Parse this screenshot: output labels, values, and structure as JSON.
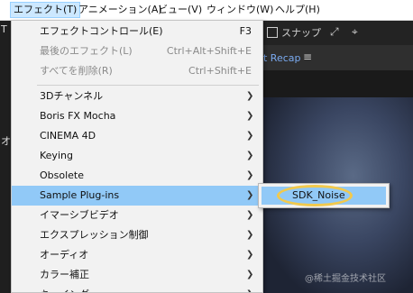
{
  "menubar": {
    "items": [
      {
        "label": "エフェクト(T)",
        "active": true
      },
      {
        "label": "アニメーション(A)",
        "active": false
      },
      {
        "label": "ビュー(V)",
        "active": false
      },
      {
        "label": "ウィンドウ(W)",
        "active": false
      },
      {
        "label": "ヘルプ(H)",
        "active": false
      }
    ]
  },
  "toolbar": {
    "snap_label": "スナップ",
    "icons": [
      "pin-icon",
      "target-icon"
    ]
  },
  "panel": {
    "recap_label": "t Recap",
    "menu_icon": "hamburger-icon"
  },
  "left_glyphs": [
    "T",
    "オ"
  ],
  "dropdown": {
    "items": [
      {
        "label": "エフェクトコントロール(E)",
        "shortcut": "F3",
        "disabled": false,
        "submenu": false
      },
      {
        "label": "最後のエフェクト(L)",
        "shortcut": "Ctrl+Alt+Shift+E",
        "disabled": true,
        "submenu": false
      },
      {
        "label": "すべてを削除(R)",
        "shortcut": "Ctrl+Shift+E",
        "disabled": true,
        "submenu": false
      },
      {
        "label": "3Dチャンネル",
        "shortcut": "",
        "disabled": false,
        "submenu": true
      },
      {
        "label": "Boris FX Mocha",
        "shortcut": "",
        "disabled": false,
        "submenu": true
      },
      {
        "label": "CINEMA 4D",
        "shortcut": "",
        "disabled": false,
        "submenu": true
      },
      {
        "label": "Keying",
        "shortcut": "",
        "disabled": false,
        "submenu": true
      },
      {
        "label": "Obsolete",
        "shortcut": "",
        "disabled": false,
        "submenu": true
      },
      {
        "label": "Sample Plug-ins",
        "shortcut": "",
        "disabled": false,
        "submenu": true,
        "highlighted": true
      },
      {
        "label": "イマーシブビデオ",
        "shortcut": "",
        "disabled": false,
        "submenu": true
      },
      {
        "label": "エクスプレッション制御",
        "shortcut": "",
        "disabled": false,
        "submenu": true
      },
      {
        "label": "オーディオ",
        "shortcut": "",
        "disabled": false,
        "submenu": true
      },
      {
        "label": "カラー補正",
        "shortcut": "",
        "disabled": false,
        "submenu": true
      },
      {
        "label": "キーイング",
        "shortcut": "",
        "disabled": false,
        "submenu": true
      }
    ]
  },
  "submenu": {
    "items": [
      {
        "label": "SDK_Noise"
      }
    ]
  },
  "watermark": "@稀土掘金技术社区",
  "colors": {
    "highlight": "#91c9f7",
    "annotation_ring": "#f2c94c",
    "menubar_active": "#cce8ff"
  }
}
